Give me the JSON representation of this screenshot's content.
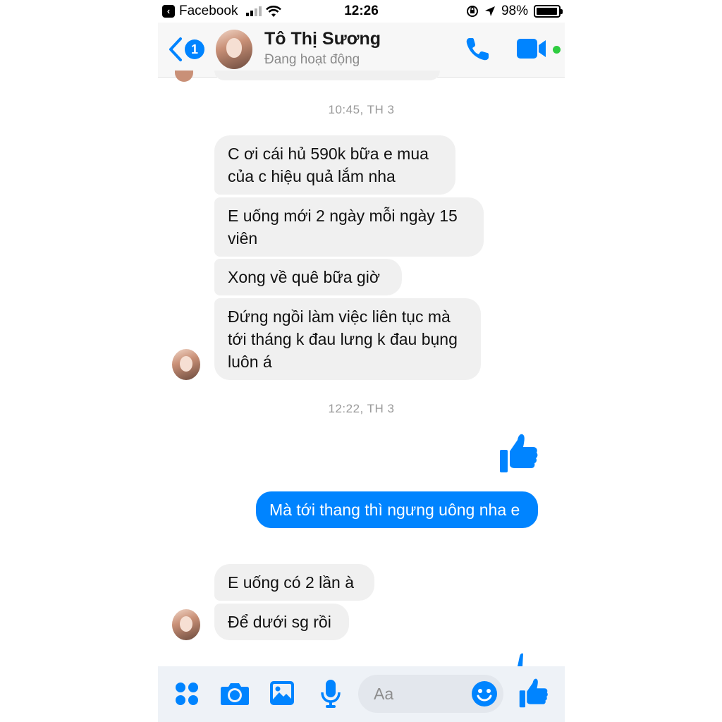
{
  "status_bar": {
    "back_app": "Facebook",
    "time": "12:26",
    "battery": "98%"
  },
  "header": {
    "unread_count": "1",
    "contact_name": "Tô Thị Sương",
    "contact_status": "Đang hoạt động"
  },
  "messages": {
    "stamp1": "10:45, TH 3",
    "m1": "C ơi cái hủ 590k bữa e mua của c hiệu quả lắm nha",
    "m2": "E uống mới 2 ngày mỗi ngày 15 viên",
    "m3": "Xong về quê bữa giờ",
    "m4": "Đứng ngồi làm việc liên tục mà tới tháng k đau lưng k đau bụng luôn á",
    "stamp2": "12:22, TH 3",
    "m5": "Mà tới thang thì ngưng uông nha e",
    "m6": "E uống có 2 lần à",
    "m7": "Để dưới sg rồi"
  },
  "composer": {
    "placeholder": "Aa"
  },
  "colors": {
    "accent": "#0084ff",
    "incoming_bubble": "#f0f0f0",
    "online": "#2ecc40"
  },
  "icons": [
    "grid-icon",
    "camera-icon",
    "photo-icon",
    "microphone-icon",
    "smile-icon",
    "thumbs-up-icon",
    "phone-icon",
    "video-icon",
    "back-chevron-icon",
    "wifi-icon",
    "signal-icon",
    "location-icon",
    "rotation-lock-icon",
    "battery-icon"
  ]
}
